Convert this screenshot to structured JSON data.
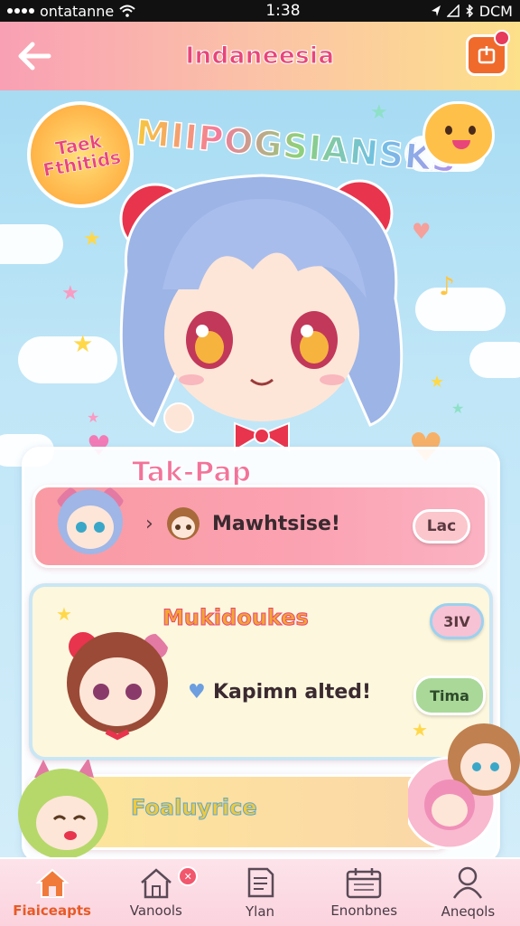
{
  "status_bar": {
    "carrier": "ontatanne",
    "time": "1:38",
    "right_text": "DCM"
  },
  "header": {
    "title": "Indaneesia",
    "back_icon": "arrow-left-icon",
    "action_icon": "notification-icon"
  },
  "hero": {
    "badge_lines": [
      "Taek",
      "Fthitids"
    ],
    "title": "MIIPOGSIANSKS"
  },
  "panel": {
    "title": "Tak-Pap"
  },
  "cards": [
    {
      "text": "Mawhtsise!",
      "button": "Lac"
    },
    {
      "title": "Mukidoukes",
      "text": "Kapimn alted!",
      "button_top": "3IV",
      "button_bottom": "Tima"
    },
    {
      "title": "Foaluyrice"
    }
  ],
  "nav": {
    "items": [
      {
        "label": "Fiaiceapts",
        "icon": "home-icon",
        "active": true
      },
      {
        "label": "Vanools",
        "icon": "house-outline-icon",
        "active": false
      },
      {
        "label": "Ylan",
        "icon": "document-icon",
        "active": false
      },
      {
        "label": "Enonbnes",
        "icon": "calendar-icon",
        "active": false
      },
      {
        "label": "Aneqols",
        "icon": "user-icon",
        "active": false
      }
    ]
  },
  "colors": {
    "header_gradient_start": "#f9a0b4",
    "header_gradient_end": "#fde08a",
    "accent_pink": "#e8457a",
    "accent_orange": "#f06a2c",
    "sky": "#9fd8f2"
  }
}
